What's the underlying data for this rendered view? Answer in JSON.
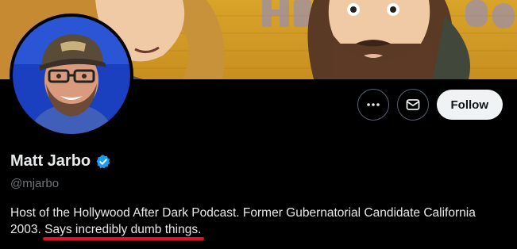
{
  "profile": {
    "name": "Matt Jarbo",
    "handle": "@mjarbo",
    "bio_part1": "Host of the Hollywood After Dark Podcast. Former Gubernatorial Candidate California 2003. ",
    "bio_highlight": "Says incredibly dumb things.",
    "verified": true
  },
  "actions": {
    "more_icon": "more-icon",
    "message_icon": "envelope-icon",
    "follow_label": "Follow"
  },
  "colors": {
    "verified_blue": "#1d9bf0",
    "highlight_red": "#e0102a",
    "banner_wall": "#e2b02c"
  }
}
